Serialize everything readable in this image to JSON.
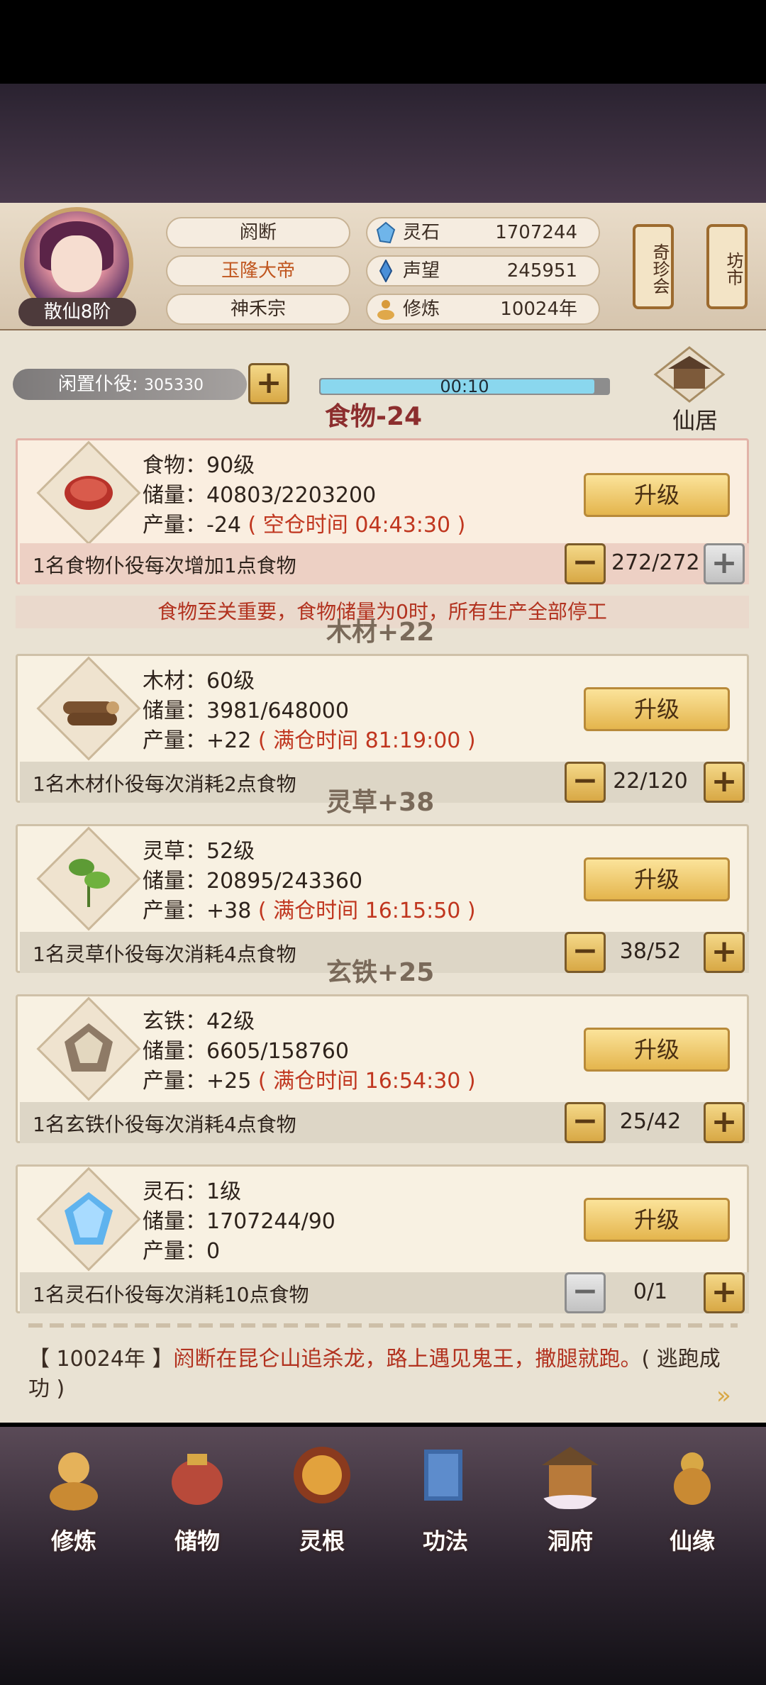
{
  "header": {
    "rank": "散仙8阶",
    "name": "阏断",
    "title": "玉隆大帝",
    "sect": "神禾宗",
    "resources": [
      {
        "label": "灵石",
        "value": "1707244",
        "icon": "spirit-stone-icon"
      },
      {
        "label": "声望",
        "value": "245951",
        "icon": "reputation-icon"
      },
      {
        "label": "修炼",
        "value": "10024年",
        "icon": "cultivation-icon"
      }
    ],
    "banners": [
      "奇珍会",
      "坊市"
    ]
  },
  "idle": {
    "label": "闲置仆役",
    "count": "305330"
  },
  "timer": {
    "text": "00:10",
    "progress": 0.95
  },
  "residence_label": "仙居",
  "floating": [
    "食物-24",
    "木材+22",
    "灵草+38",
    "玄铁+25"
  ],
  "upgrade_label": "升级",
  "rows": [
    {
      "name": "食物：90级",
      "storage": "储量：40803/2203200",
      "output_prefix": "产量：-24",
      "output_note": "( 空仓时间 04:43:30 )",
      "desc": "1名食物仆役每次增加1点食物",
      "count": "272/272",
      "minus_enabled": true,
      "plus_enabled": false,
      "icon": "meat-icon"
    },
    {
      "name": "木材：60级",
      "storage": "储量：3981/648000",
      "output_prefix": "产量：+22",
      "output_note": "( 满仓时间 81:19:00 )",
      "desc": "1名木材仆役每次消耗2点食物",
      "count": "22/120",
      "minus_enabled": true,
      "plus_enabled": true,
      "icon": "logs-icon"
    },
    {
      "name": "灵草：52级",
      "storage": "储量：20895/243360",
      "output_prefix": "产量：+38",
      "output_note": "( 满仓时间 16:15:50 )",
      "desc": "1名灵草仆役每次消耗4点食物",
      "count": "38/52",
      "minus_enabled": true,
      "plus_enabled": true,
      "icon": "herb-icon"
    },
    {
      "name": "玄铁：42级",
      "storage": "储量：6605/158760",
      "output_prefix": "产量：+25",
      "output_note": "( 满仓时间 16:54:30 )",
      "desc": "1名玄铁仆役每次消耗4点食物",
      "count": "25/42",
      "minus_enabled": true,
      "plus_enabled": true,
      "icon": "ore-icon"
    },
    {
      "name": "灵石：1级",
      "storage": "储量：1707244/90",
      "output_prefix": "产量：0",
      "output_note": "",
      "desc": "1名灵石仆役每次消耗10点食物",
      "count": "0/1",
      "minus_enabled": false,
      "plus_enabled": true,
      "icon": "crystal-icon"
    }
  ],
  "warning": "食物至关重要，食物储量为0时，所有生产全部停工",
  "log": {
    "year": "【 10024年 】",
    "body": "阏断在昆仑山追杀龙，路上遇见鬼王，撒腿就跑。",
    "result": "( 逃跑成功 )"
  },
  "nav": [
    {
      "label": "修炼",
      "icon": "monk-icon"
    },
    {
      "label": "储物",
      "icon": "bag-icon"
    },
    {
      "label": "灵根",
      "icon": "taiji-icon"
    },
    {
      "label": "功法",
      "icon": "book-icon"
    },
    {
      "label": "洞府",
      "icon": "pavilion-icon"
    },
    {
      "label": "仙缘",
      "icon": "gourd-icon"
    }
  ],
  "colors": {
    "accent_gold": "#e4b54d",
    "warning_red": "#b2321f",
    "bar_blue": "#8ad7ee"
  }
}
